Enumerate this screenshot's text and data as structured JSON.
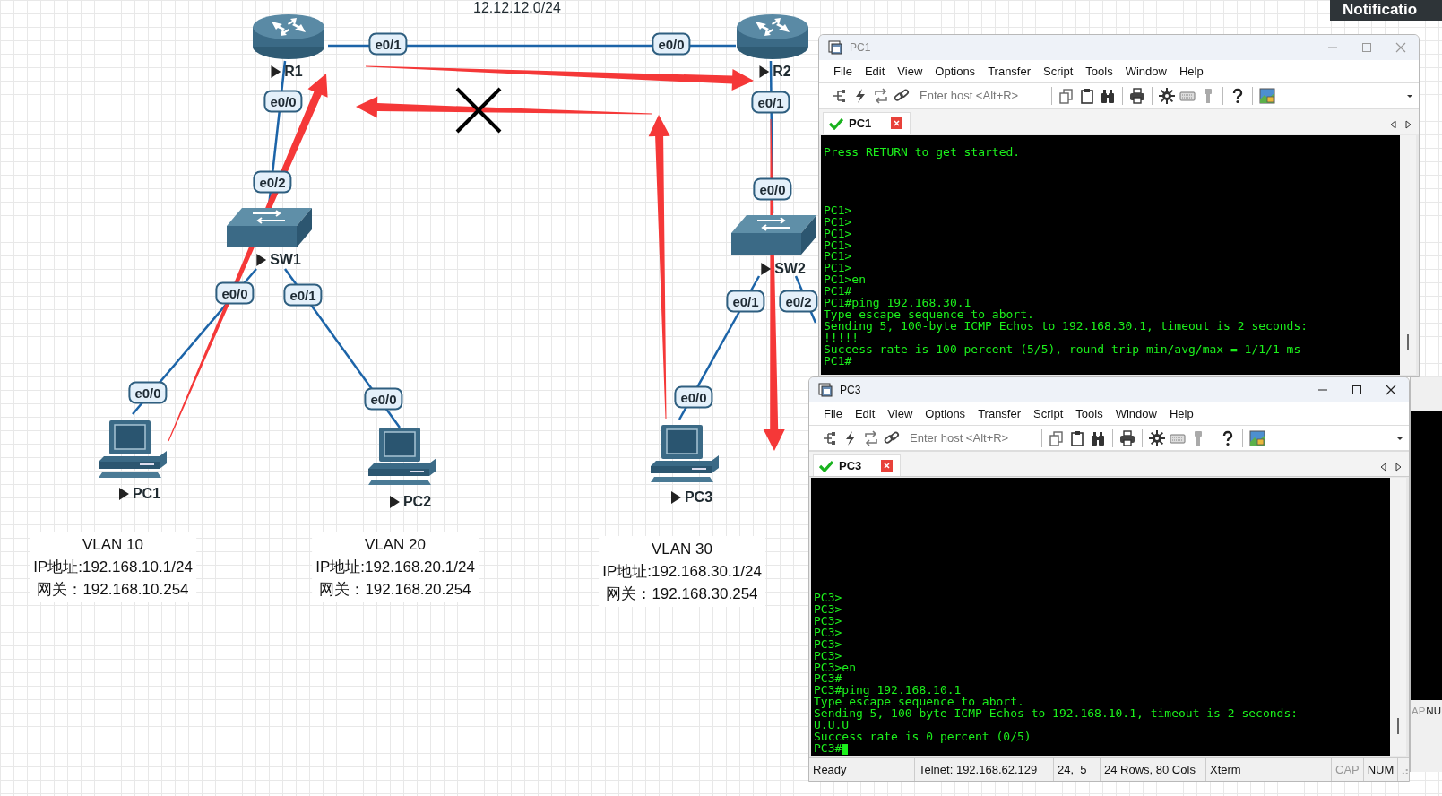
{
  "diagram": {
    "subnet_label": "12.12.12.0/24",
    "devices": [
      {
        "kind": "router",
        "name": "R1"
      },
      {
        "kind": "router",
        "name": "R2"
      },
      {
        "kind": "switch",
        "name": "SW1"
      },
      {
        "kind": "switch",
        "name": "SW2"
      },
      {
        "kind": "pc",
        "name": "PC1"
      },
      {
        "kind": "pc",
        "name": "PC2"
      },
      {
        "kind": "pc",
        "name": "PC3"
      }
    ],
    "ports": [
      {
        "label": "e0/1"
      },
      {
        "label": "e0/0"
      },
      {
        "label": "e0/0"
      },
      {
        "label": "e0/2"
      },
      {
        "label": "e0/0"
      },
      {
        "label": "e0/1"
      },
      {
        "label": "e0/0"
      },
      {
        "label": "e0/0"
      },
      {
        "label": "e0/1"
      },
      {
        "label": "e0/0"
      },
      {
        "label": "e0/1"
      },
      {
        "label": "e0/2"
      },
      {
        "label": "e0/0"
      }
    ],
    "vlans": [
      {
        "title": "VLAN 10",
        "ip": "IP地址:192.168.10.1/24",
        "gateway": "网关：192.168.10.254"
      },
      {
        "title": "VLAN 20",
        "ip": "IP地址:192.168.20.1/24",
        "gateway": "网关：192.168.20.254"
      },
      {
        "title": "VLAN 30",
        "ip": "IP地址:192.168.30.1/24",
        "gateway": "网关：192.168.30.254"
      }
    ]
  },
  "background_window": {
    "indicators": [
      "AP",
      "NU"
    ]
  },
  "windows": [
    {
      "title": "PC1",
      "active": false,
      "menu": [
        "File",
        "Edit",
        "View",
        "Options",
        "Transfer",
        "Script",
        "Tools",
        "Window",
        "Help"
      ],
      "host_placeholder": "Enter host <Alt+R>",
      "tab": {
        "label": "PC1",
        "connected": true
      },
      "terminal": {
        "banner": "Press RETURN to get started.",
        "cursor": false,
        "lines": [
          "PC1>",
          "PC1>",
          "PC1>",
          "PC1>",
          "PC1>",
          "PC1>",
          "PC1>en",
          "PC1#",
          "PC1#ping 192.168.30.1",
          "Type escape sequence to abort.",
          "Sending 5, 100-byte ICMP Echos to 192.168.30.1, timeout is 2 seconds:",
          "!!!!!",
          "Success rate is 100 percent (5/5), round-trip min/avg/max = 1/1/1 ms",
          "PC1#"
        ]
      }
    },
    {
      "title": "PC3",
      "active": true,
      "menu": [
        "File",
        "Edit",
        "View",
        "Options",
        "Transfer",
        "Script",
        "Tools",
        "Window",
        "Help"
      ],
      "host_placeholder": "Enter host <Alt+R>",
      "tab": {
        "label": "PC3",
        "connected": true
      },
      "terminal": {
        "cursor": true,
        "lines": [
          "PC3>",
          "PC3>",
          "PC3>",
          "PC3>",
          "PC3>",
          "PC3>",
          "PC3>en",
          "PC3#",
          "PC3#ping 192.168.10.1",
          "Type escape sequence to abort.",
          "Sending 5, 100-byte ICMP Echos to 192.168.10.1, timeout is 2 seconds:",
          "U.U.U",
          "Success rate is 0 percent (0/5)",
          "PC3#"
        ]
      },
      "status_bar": {
        "cells": [
          "Ready",
          "Telnet: 192.168.62.129",
          "24,  5",
          "24 Rows, 80 Cols",
          "Xterm"
        ],
        "indicators": [
          {
            "label": "CAP",
            "on": false
          },
          {
            "label": "NUM",
            "on": true
          }
        ]
      }
    }
  ],
  "notification": "Notificatio"
}
